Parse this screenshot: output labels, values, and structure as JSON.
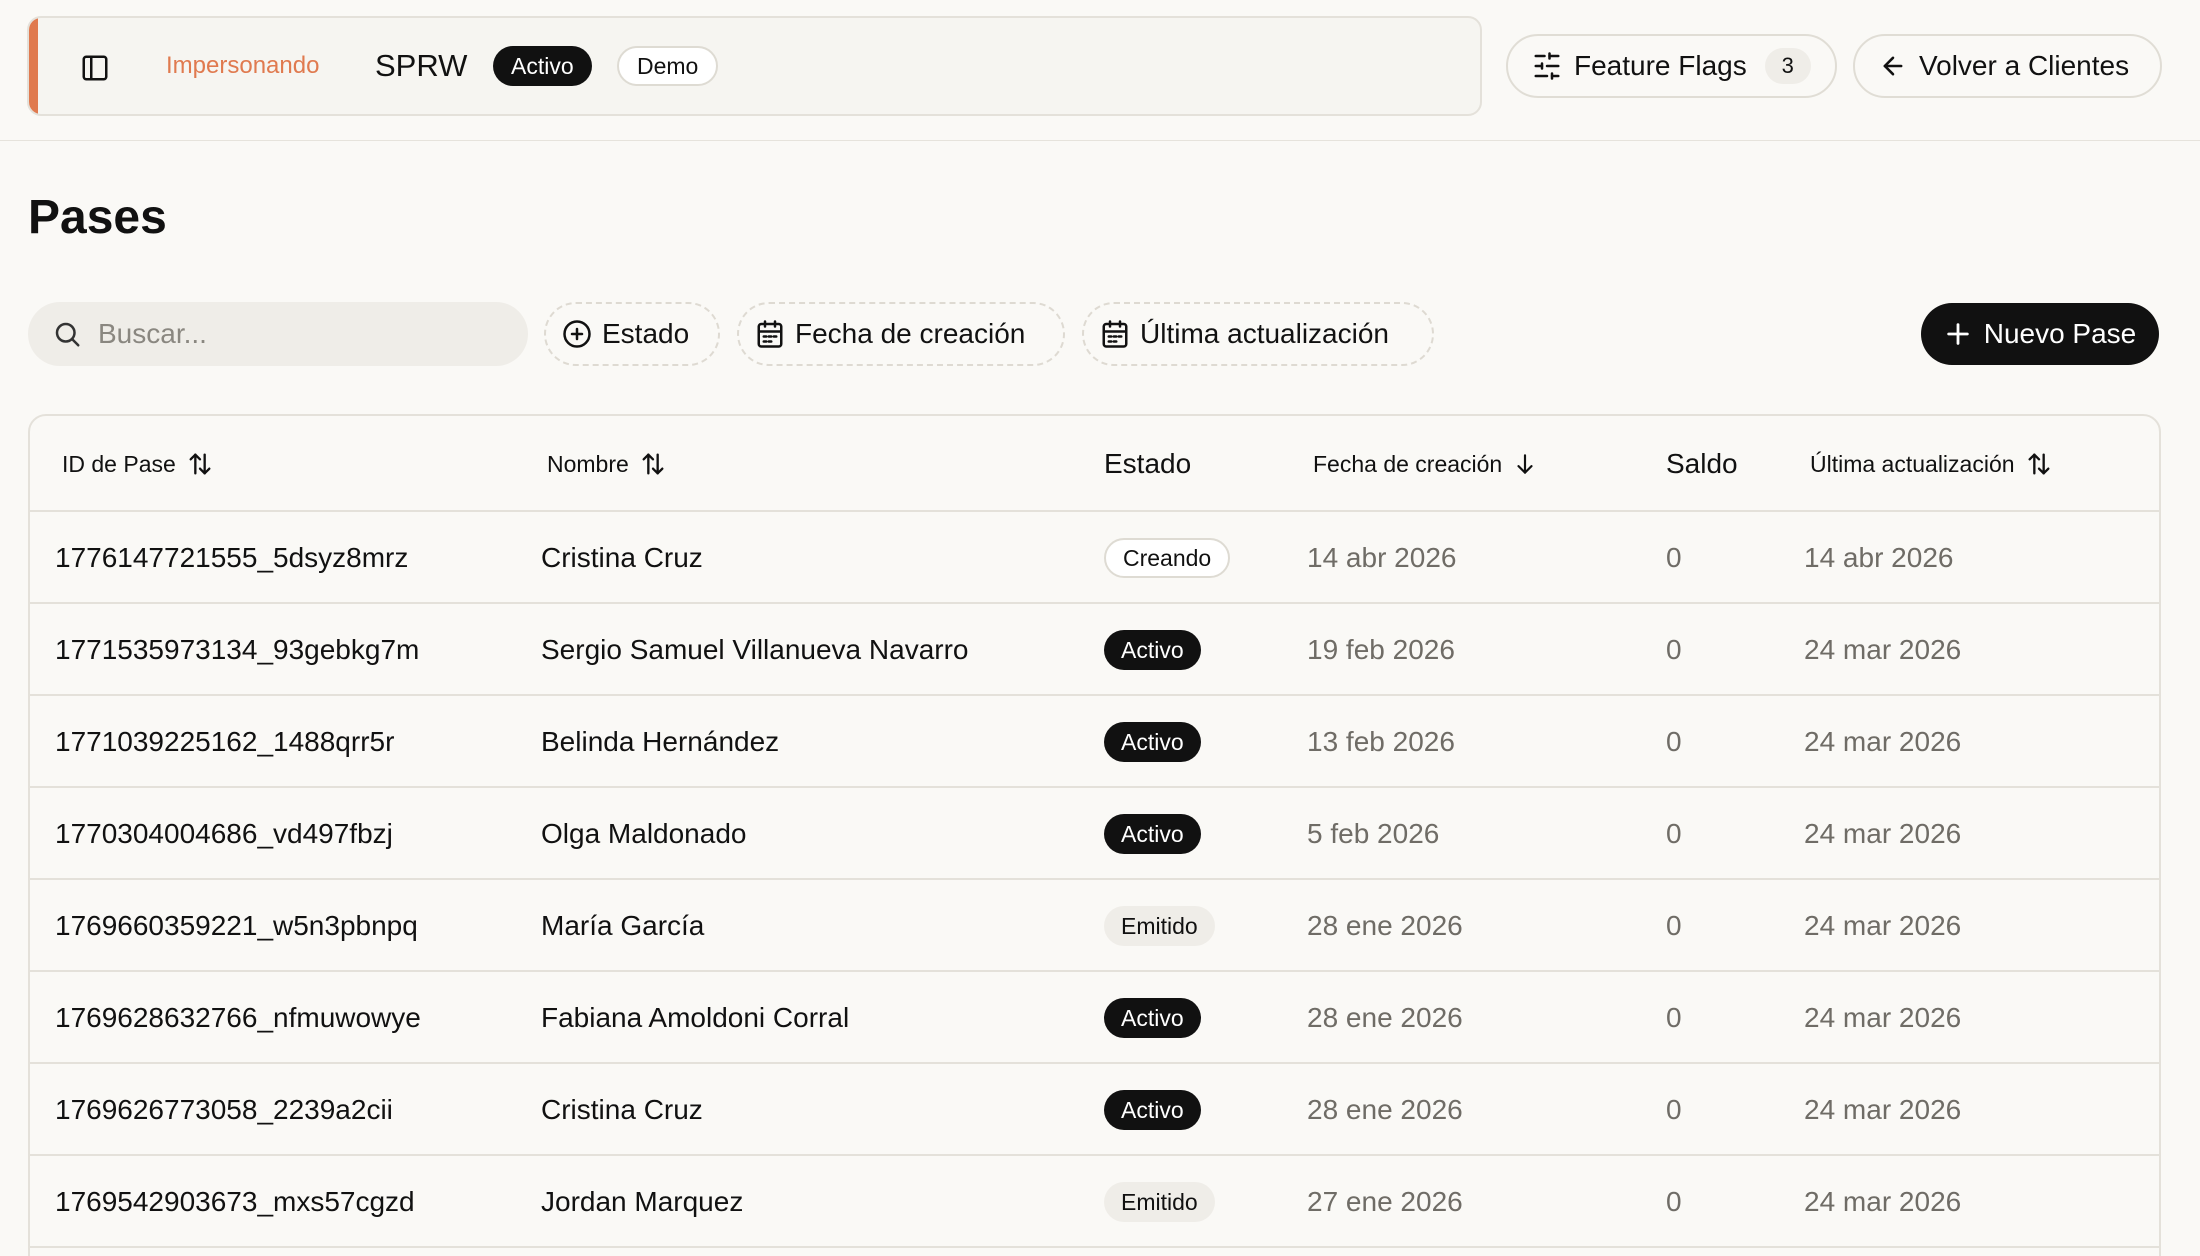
{
  "header": {
    "impersonating_label": "Impersonando",
    "tenant_name": "SPRW",
    "tenant_status": "Activo",
    "tenant_env": "Demo",
    "feature_flags_label": "Feature Flags",
    "feature_flags_count": "3",
    "back_label": "Volver a Clientes"
  },
  "page": {
    "title": "Pases"
  },
  "toolbar": {
    "search_placeholder": "Buscar...",
    "filter_status": "Estado",
    "filter_created": "Fecha de creación",
    "filter_updated": "Última actualización",
    "new_button": "Nuevo Pase"
  },
  "table": {
    "columns": {
      "id": "ID de Pase",
      "name": "Nombre",
      "status": "Estado",
      "created": "Fecha de creación",
      "balance": "Saldo",
      "updated": "Última actualización"
    },
    "rows": [
      {
        "id": "1776147721555_5dsyz8mrz",
        "name": "Cristina Cruz",
        "status": "Creando",
        "created": "14 abr 2026",
        "balance": "0",
        "updated": "14 abr 2026"
      },
      {
        "id": "1771535973134_93gebkg7m",
        "name": "Sergio Samuel Villanueva Navarro",
        "status": "Activo",
        "created": "19 feb 2026",
        "balance": "0",
        "updated": "24 mar 2026"
      },
      {
        "id": "1771039225162_1488qrr5r",
        "name": "Belinda Hernández",
        "status": "Activo",
        "created": "13 feb 2026",
        "balance": "0",
        "updated": "24 mar 2026"
      },
      {
        "id": "1770304004686_vd497fbzj",
        "name": "Olga Maldonado",
        "status": "Activo",
        "created": "5 feb 2026",
        "balance": "0",
        "updated": "24 mar 2026"
      },
      {
        "id": "1769660359221_w5n3pbnpq",
        "name": "María García",
        "status": "Emitido",
        "created": "28 ene 2026",
        "balance": "0",
        "updated": "24 mar 2026"
      },
      {
        "id": "1769628632766_nfmuwowye",
        "name": "Fabiana Amoldoni Corral",
        "status": "Activo",
        "created": "28 ene 2026",
        "balance": "0",
        "updated": "24 mar 2026"
      },
      {
        "id": "1769626773058_2239a2cii",
        "name": "Cristina Cruz",
        "status": "Activo",
        "created": "28 ene 2026",
        "balance": "0",
        "updated": "24 mar 2026"
      },
      {
        "id": "1769542903673_mxs57cgzd",
        "name": "Jordan Marquez",
        "status": "Emitido",
        "created": "27 ene 2026",
        "balance": "0",
        "updated": "24 mar 2026"
      }
    ]
  },
  "colors": {
    "accent": "#e07a4f",
    "primary": "#111111",
    "background": "#faf9f6"
  },
  "icons": [
    "sidebar-toggle-icon",
    "sliders-icon",
    "arrow-left-icon",
    "search-icon",
    "plus-circle-icon",
    "calendar-icon",
    "plus-icon",
    "sort-icon",
    "arrow-down-icon"
  ]
}
